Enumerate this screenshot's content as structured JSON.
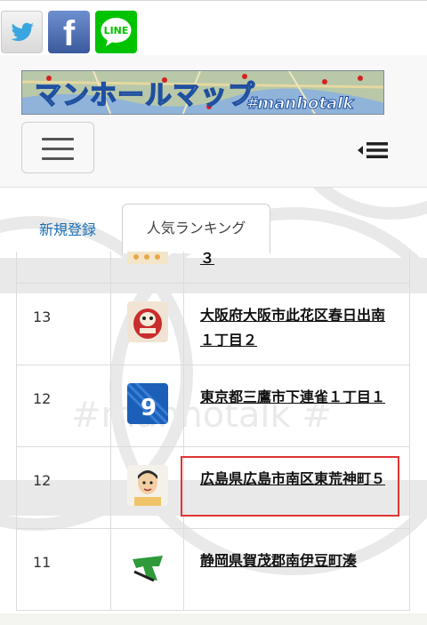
{
  "share": {
    "twitter_icon": "twitter-bird-icon",
    "facebook_label": "f",
    "line_label": "LINE"
  },
  "brand": {
    "title": "マンホールマップ",
    "tagline": "#manhotalk"
  },
  "tabs": [
    {
      "label": "新規登録"
    },
    {
      "label": "人気ランキング"
    }
  ],
  "ranking": {
    "rows": [
      {
        "count": "",
        "name": "３",
        "thumb_icon": "daruma-icon"
      },
      {
        "count": "13",
        "name": "大阪府大阪市此花区春日出南１丁目２",
        "thumb_icon": "daruma-icon"
      },
      {
        "count": "12",
        "name": "東京都三鷹市下連雀１丁目１",
        "thumb_icon": "jersey-9-icon"
      },
      {
        "count": "12",
        "name": "広島県広島市南区東荒神町５",
        "thumb_icon": "avatar-face-icon"
      },
      {
        "count": "11",
        "name": "静岡県賀茂郡南伊豆町湊",
        "thumb_icon": "green-m-logo-icon"
      }
    ]
  },
  "colors": {
    "link": "#1a6fb5",
    "highlight": "#e03535",
    "line_green": "#00c300",
    "facebook_blue": "#3b5a9e"
  }
}
